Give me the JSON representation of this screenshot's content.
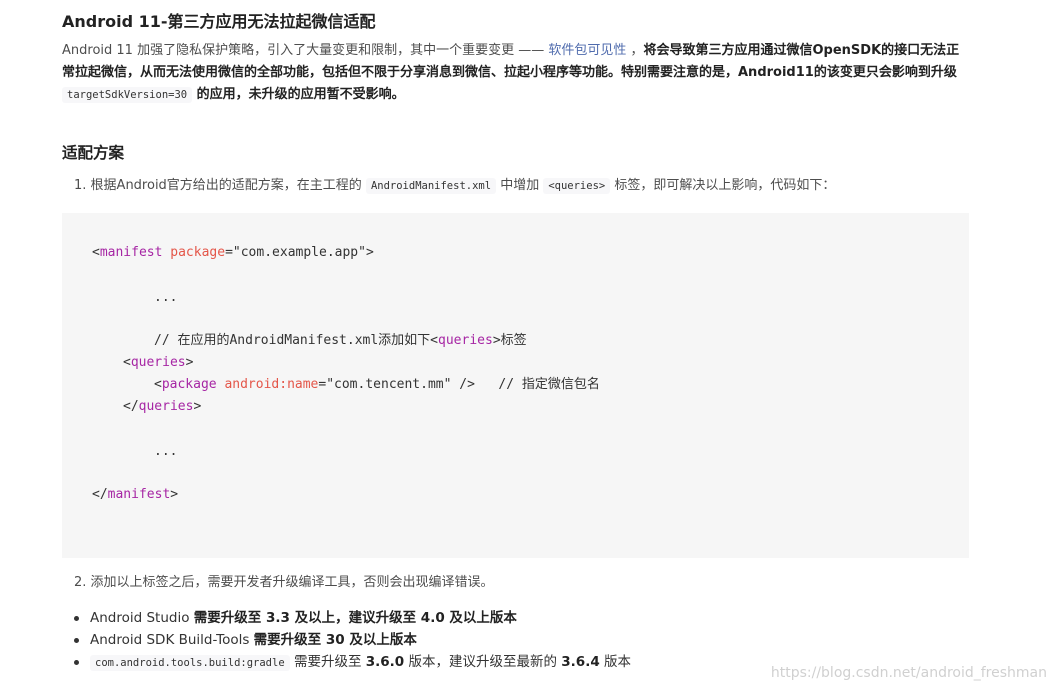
{
  "heading": "Android 11-第三方应用无法拉起微信适配",
  "intro": {
    "p1": "Android 11 加强了隐私保护策略，引入了大量变更和限制，其中一个重要变更 —— ",
    "link": "软件包可见性",
    "p2": " ，",
    "bold1": "将会导致第三方应用通过微信OpenSDK的接口无法正常拉起微信，从而无法使用微信的全部功能，包括但不限于分享消息到微信、拉起小程序等功能。特别需要注意的是，Android11的该变更只会影响到升级 ",
    "code": "targetSdkVersion=30",
    "bold2": " 的应用，未升级的应用暂不受影响。"
  },
  "section_title": "适配方案",
  "step1": {
    "num": "1.",
    "t1": "根据Android官方给出的适配方案，在主工程的 ",
    "code1": "AndroidManifest.xml",
    "t2": " 中增加 ",
    "code2": "<queries>",
    "t3": " 标签，即可解决以上影响，代码如下："
  },
  "code": {
    "l1_open": "<",
    "l1_tag": "manifest",
    "l1_attr": " package",
    "l1_eq": "=",
    "l1_val": "\"com.example.app\"",
    "l1_close": ">",
    "dots1": "...",
    "comment_a": "// 在应用的AndroidManifest.xml添加如下<",
    "comment_tag": "queries",
    "comment_b": ">标签",
    "q_open": "<",
    "q_tag": "queries",
    "q_close": ">",
    "p_open": "<",
    "p_tag": "package",
    "p_attr": " android:name",
    "p_eq": "=",
    "p_val": "\"com.tencent.mm\"",
    "p_end": " />   ",
    "p_comment": "// 指定微信包名",
    "qe_open": "</",
    "qe_tag": "queries",
    "qe_close": ">",
    "dots2": "...",
    "me_open": "</",
    "me_tag": "manifest",
    "me_close": ">"
  },
  "step2": {
    "num": "2.",
    "text": "添加以上标签之后，需要开发者升级编译工具，否则会出现编译错误。"
  },
  "bullets": [
    {
      "pre": "Android Studio ",
      "bold": "需要升级至 3.3 及以上，建议升级至 4.0 及以上版本"
    },
    {
      "pre": "Android SDK Build-Tools ",
      "bold": "需要升级至 30 及以上版本"
    },
    {
      "code": "com.android.tools.build:gradle",
      "t1": " 需要升级至 ",
      "v1": "3.6.0",
      "t2": " 版本，建议升级至最新的 ",
      "v2": "3.6.4",
      "t3": " 版本"
    }
  ],
  "watermark": "https://blog.csdn.net/android_freshman"
}
